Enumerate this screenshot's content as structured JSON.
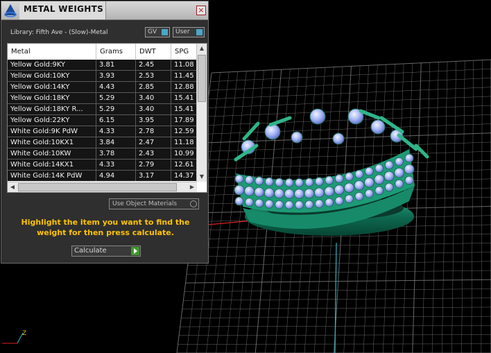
{
  "dialog": {
    "title": "METAL WEIGHTS",
    "close": "×",
    "library_label": "Library: Fifth Ave - (Slow)-Metal",
    "gv_toggle": "GV",
    "user_toggle": "User",
    "columns": [
      "Metal",
      "Grams",
      "DWT",
      "SPG"
    ],
    "rows": [
      [
        "Yellow Gold:9KY",
        "3.81",
        "2.45",
        "11.08"
      ],
      [
        "Yellow Gold:10KY",
        "3.93",
        "2.53",
        "11.45"
      ],
      [
        "Yellow Gold:14KY",
        "4.43",
        "2.85",
        "12.88"
      ],
      [
        "Yellow Gold:18KY",
        "5.29",
        "3.40",
        "15.41"
      ],
      [
        "Yellow Gold:18KY R...",
        "5.29",
        "3.40",
        "15.41"
      ],
      [
        "Yellow Gold:22KY",
        "6.15",
        "3.95",
        "17.89"
      ],
      [
        "White Gold:9K PdW",
        "4.33",
        "2.78",
        "12.59"
      ],
      [
        "White Gold:10KX1",
        "3.84",
        "2.47",
        "11.18"
      ],
      [
        "White Gold:10KW",
        "3.78",
        "2.43",
        "10.99"
      ],
      [
        "White Gold:14KX1",
        "4.33",
        "2.79",
        "12.61"
      ],
      [
        "White Gold:14K PdW",
        "4.94",
        "3.17",
        "14.37"
      ]
    ],
    "use_object_materials": "Use Object Materials",
    "hint": "Highlight the item you want to find the weight for then press calculate.",
    "calculate": "Calculate"
  },
  "viewport": {
    "axis_label_z": "Z"
  },
  "colors": {
    "ring": "#1f8f72",
    "gems": "#b8c8ff",
    "grid": "#8a8a8a",
    "hint": "#ffc400"
  }
}
